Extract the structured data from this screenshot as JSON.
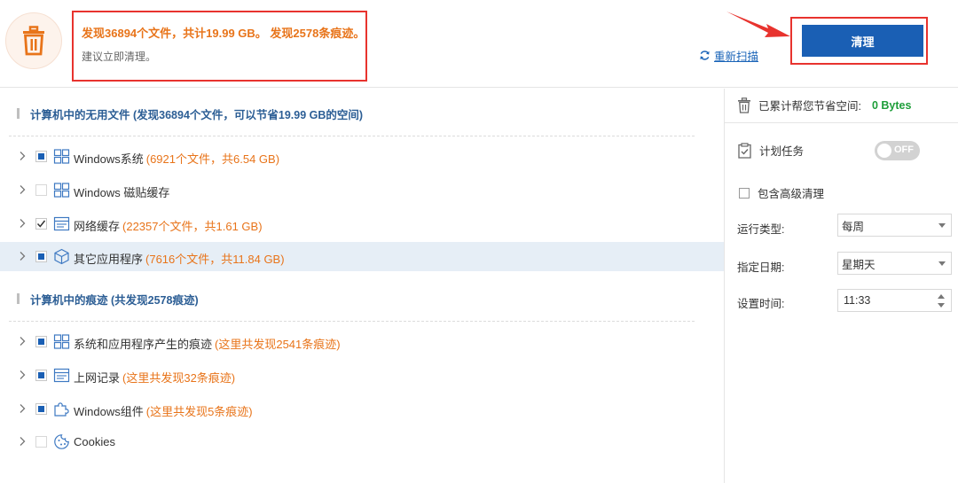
{
  "header": {
    "summary_main": "发现36894个文件，共计19.99 GB。 发现2578条痕迹。",
    "summary_sub": "建议立即清理。",
    "rescan_label": "重新扫描",
    "clean_label": "清理"
  },
  "junk_section": {
    "title": "计算机中的无用文件 (发现36894个文件，可以节省19.99 GB的空间)",
    "items": [
      {
        "label": "Windows系统",
        "detail": "(6921个文件，共6.54 GB)",
        "check": "partial",
        "icon": "windows-icon"
      },
      {
        "label": "Windows 磁贴缓存",
        "detail": "",
        "check": "unchecked",
        "icon": "windows-icon"
      },
      {
        "label": "网络缓存",
        "detail": "(22357个文件，共1.61 GB)",
        "check": "checked",
        "icon": "browser-icon"
      },
      {
        "label": "其它应用程序",
        "detail": "(7616个文件，共11.84 GB)",
        "check": "partial",
        "icon": "package-icon",
        "selected": true
      }
    ]
  },
  "trace_section": {
    "title": "计算机中的痕迹 (共发现2578痕迹)",
    "items": [
      {
        "label": "系统和应用程序产生的痕迹",
        "detail": "(这里共发现2541条痕迹)",
        "check": "partial",
        "icon": "windows-icon"
      },
      {
        "label": "上网记录",
        "detail": "(这里共发现32条痕迹)",
        "check": "partial",
        "icon": "browser-icon"
      },
      {
        "label": "Windows组件",
        "detail": "(这里共发现5条痕迹)",
        "check": "partial",
        "icon": "puzzle-icon"
      },
      {
        "label": "Cookies",
        "detail": "",
        "check": "unchecked",
        "icon": "cookie-icon"
      }
    ]
  },
  "sidebar": {
    "saved_label": "已累计帮您节省空间:",
    "saved_value": "0 Bytes",
    "schedule_label": "计划任务",
    "schedule_toggle": "OFF",
    "advanced_label": "包含高级清理",
    "run_type_label": "运行类型:",
    "run_type_value": "每周",
    "date_label": "指定日期:",
    "date_value": "星期天",
    "time_label": "设置时间:",
    "time_value": "11:33"
  },
  "colors": {
    "accent_blue": "#1a5fb4",
    "orange_text": "#e8741a",
    "highlight_red": "#e8332e",
    "saved_green": "#1e9e3a"
  }
}
